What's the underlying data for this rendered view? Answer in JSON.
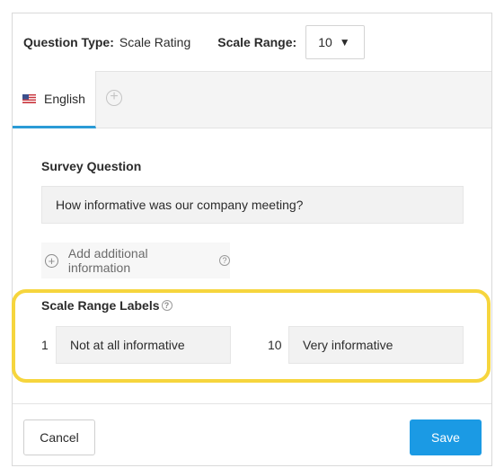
{
  "top_bar": {
    "question_type_label": "Question Type:",
    "question_type_value": "Scale Rating",
    "scale_range_label": "Scale Range:",
    "scale_range_value": "10",
    "caret_glyph": "▼"
  },
  "tabs": {
    "active_label": "English",
    "flag_icon": "us-flag-icon",
    "add_glyph": "+"
  },
  "survey_question": {
    "title": "Survey Question",
    "value": "How informative was our company meeting?"
  },
  "add_info": {
    "label": "Add additional information",
    "plus_glyph": "+",
    "help_glyph": "?"
  },
  "scale_labels": {
    "title": "Scale Range Labels",
    "help_glyph": "?",
    "low_number": "1",
    "low_label": "Not at all informative",
    "high_number": "10",
    "high_label": "Very informative"
  },
  "footer": {
    "cancel_label": "Cancel",
    "save_label": "Save"
  },
  "colors": {
    "accent_blue": "#1b9ae4",
    "tab_underline": "#2b9bd6",
    "highlight_yellow": "#f6d53d"
  }
}
